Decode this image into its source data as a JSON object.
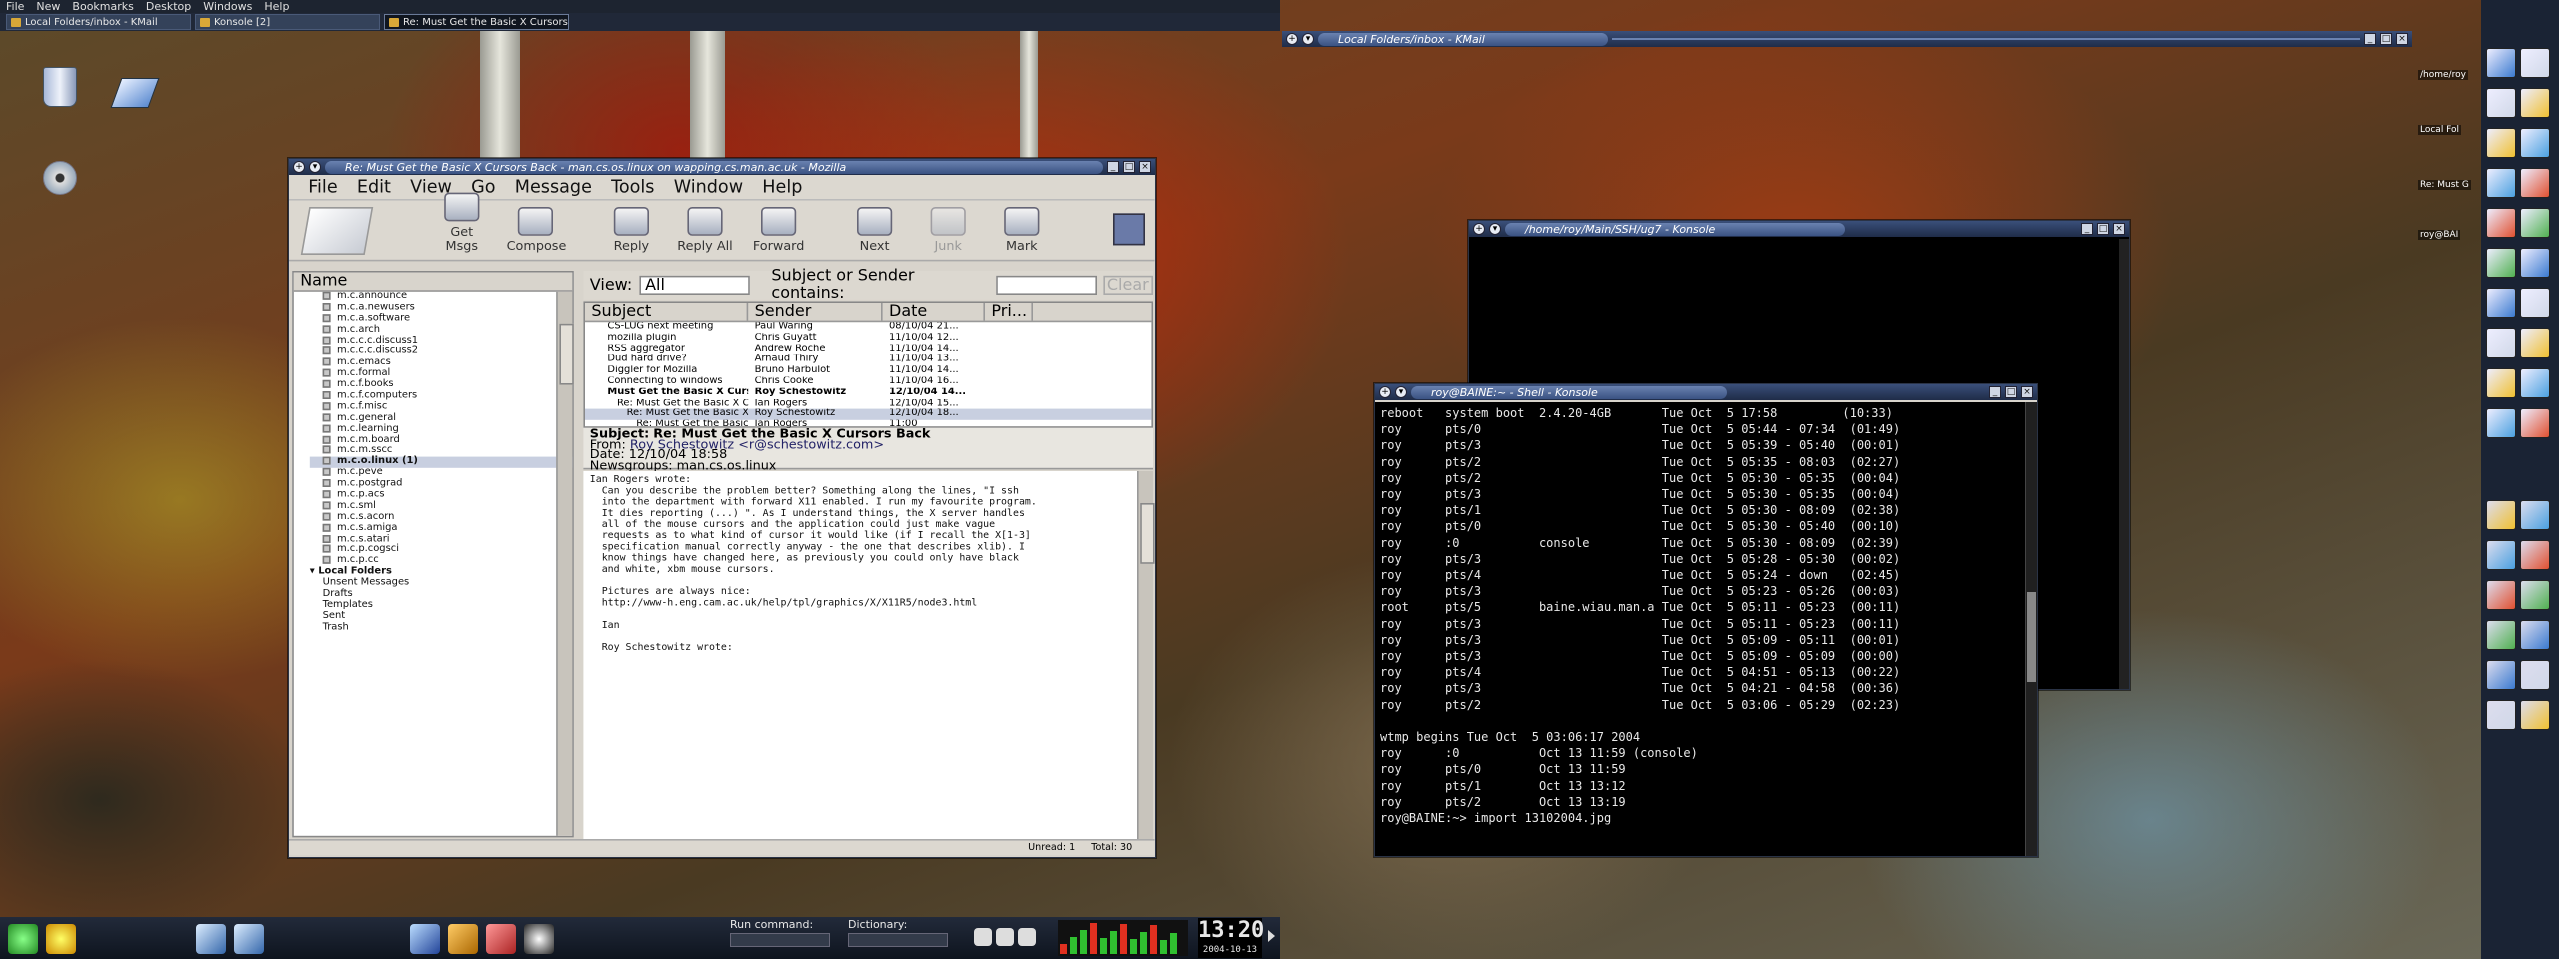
{
  "menubar": {
    "items": [
      "File",
      "New",
      "Bookmarks",
      "Desktop",
      "Windows",
      "Help"
    ]
  },
  "taskbar": {
    "tasks": [
      "Local Folders/inbox - KMail",
      "Konsole [2]",
      "Re: Must Get the Basic X Cursors B..."
    ]
  },
  "mozilla": {
    "title": "Re: Must Get the Basic X Cursors Back - man.cs.os.linux on wapping.cs.man.ac.uk - Mozilla",
    "menu": [
      "File",
      "Edit",
      "View",
      "Go",
      "Message",
      "Tools",
      "Window",
      "Help"
    ],
    "toolbar": [
      "Get Msgs",
      "Compose",
      "Reply",
      "Reply All",
      "Forward",
      "Next",
      "Junk",
      "Mark"
    ],
    "folder_header": "Name",
    "folders": [
      "m.c.announce",
      "m.c.a.newusers",
      "m.c.a.software",
      "m.c.arch",
      "m.c.c.c.discuss1",
      "m.c.c.c.discuss2",
      "m.c.emacs",
      "m.c.formal",
      "m.c.f.books",
      "m.c.f.computers",
      "m.c.f.misc",
      "m.c.general",
      "m.c.learning",
      "m.c.m.board",
      "m.c.m.sscc",
      "m.c.o.linux (1)",
      "m.c.peve",
      "m.c.postgrad",
      "m.c.p.acs",
      "m.c.sml",
      "m.c.s.acorn",
      "m.c.s.amiga",
      "m.c.s.atari",
      "m.c.p.cogsci",
      "m.c.p.cc"
    ],
    "local_folders_label": "Local Folders",
    "local_folders": [
      "Unsent Messages",
      "Drafts",
      "Templates",
      "Sent",
      "Trash"
    ],
    "view_label": "View:",
    "view_value": "All",
    "search_label": "Subject or Sender contains:",
    "clear_label": "Clear",
    "columns": [
      "Subject",
      "Sender",
      "Date",
      "Pri..."
    ],
    "messages": [
      {
        "subject": "CS-LUG next meeting",
        "sender": "Paul Waring",
        "date": "08/10/04 21..."
      },
      {
        "subject": "mozilla plugin",
        "sender": "Chris Guyatt",
        "date": "11/10/04 12..."
      },
      {
        "subject": "RSS aggregator",
        "sender": "Andrew Roche",
        "date": "11/10/04 14..."
      },
      {
        "subject": "Dud hard drive?",
        "sender": "Arnaud Thiry",
        "date": "11/10/04 13..."
      },
      {
        "subject": "Diggler for Mozilla",
        "sender": "Bruno Harbulot",
        "date": "11/10/04 14..."
      },
      {
        "subject": "Connecting to windows",
        "sender": "Chris Cooke",
        "date": "11/10/04 16..."
      },
      {
        "subject": "Must Get the Basic X Cursors Back",
        "sender": "Roy Schestowitz",
        "date": "12/10/04 14..."
      },
      {
        "subject": "Re: Must Get the Basic X Cursors ...",
        "sender": "Ian Rogers",
        "date": "12/10/04 15..."
      },
      {
        "subject": "Re: Must Get the Basic X Curso...",
        "sender": "Roy Schestowitz",
        "date": "12/10/04 18..."
      },
      {
        "subject": "Re: Must Get the Basic X Cur...",
        "sender": "Ian Rogers",
        "date": "11:00"
      }
    ],
    "headers": {
      "subject_label": "Subject:",
      "subject": "Re: Must Get the Basic X Cursors Back",
      "from_label": "From:",
      "from": "Roy Schestowitz <r@schestowitz.com>",
      "date_label": "Date:",
      "date": "12/10/04 18:58",
      "newsgroups_label": "Newsgroups:",
      "newsgroups": "man.cs.os.linux"
    },
    "body": "Ian Rogers wrote:\n  Can you describe the problem better? Something along the lines, \"I ssh\n  into the department with forward X11 enabled. I run my favourite program.\n  It dies reporting (...) \". As I understand things, the X server handles\n  all of the mouse cursors and the application could just make vague\n  requests as to what kind of cursor it would like (if I recall the X[1-3]\n  specification manual correctly anyway - the one that describes xlib). I\n  know things have changed here, as previously you could only have black\n  and white, xbm mouse cursors.\n\n  Pictures are always nice:\n  http://www-h.eng.cam.ac.uk/help/tpl/graphics/X/X11R5/node3.html\n\n  Ian\n\n  Roy Schestowitz wrote:",
    "status": {
      "unread": "Unread: 1",
      "total": "Total: 30"
    }
  },
  "kmail": {
    "title": "Local Folders/inbox - KMail"
  },
  "konsole_bg": {
    "title": "/home/roy/Main/SSH/ug7 - Konsole"
  },
  "konsole": {
    "title": "roy@BAINE:~ - Shell - Konsole",
    "text": "reboot   system boot  2.4.20-4GB       Tue Oct  5 17:58         (10:33)\nroy      pts/0                         Tue Oct  5 05:44 - 07:34  (01:49)\nroy      pts/3                         Tue Oct  5 05:39 - 05:40  (00:01)\nroy      pts/2                         Tue Oct  5 05:35 - 08:03  (02:27)\nroy      pts/2                         Tue Oct  5 05:30 - 05:35  (00:04)\nroy      pts/3                         Tue Oct  5 05:30 - 05:35  (00:04)\nroy      pts/1                         Tue Oct  5 05:30 - 08:09  (02:38)\nroy      pts/0                         Tue Oct  5 05:30 - 05:40  (00:10)\nroy      :0           console          Tue Oct  5 05:30 - 08:09  (02:39)\nroy      pts/3                         Tue Oct  5 05:28 - 05:30  (00:02)\nroy      pts/4                         Tue Oct  5 05:24 - down   (02:45)\nroy      pts/3                         Tue Oct  5 05:23 - 05:26  (00:03)\nroot     pts/5        baine.wiau.man.a Tue Oct  5 05:11 - 05:23  (00:11)\nroy      pts/3                         Tue Oct  5 05:11 - 05:23  (00:11)\nroy      pts/3                         Tue Oct  5 05:09 - 05:11  (00:01)\nroy      pts/3                         Tue Oct  5 05:09 - 05:09  (00:00)\nroy      pts/4                         Tue Oct  5 04:51 - 05:13  (00:22)\nroy      pts/3                         Tue Oct  5 04:21 - 04:58  (00:36)\nroy      pts/2                         Tue Oct  5 03:06 - 05:29  (02:23)\n\nwtmp begins Tue Oct  5 03:06:17 2004\nroy      :0           Oct 13 11:59 (console)\nroy      pts/0        Oct 13 11:59\nroy      pts/1        Oct 13 13:12\nroy      pts/2        Oct 13 13:19\nroy@BAINE:~> import 13102004.jpg"
  },
  "dock_labels": [
    "/home/roy",
    "Local Fol",
    "Re: Must G",
    "roy@BAI"
  ],
  "bottom": {
    "run_label": "Run command:",
    "dict_label": "Dictionary:",
    "clock_time": "13:20",
    "clock_date": "2004-10-13"
  }
}
